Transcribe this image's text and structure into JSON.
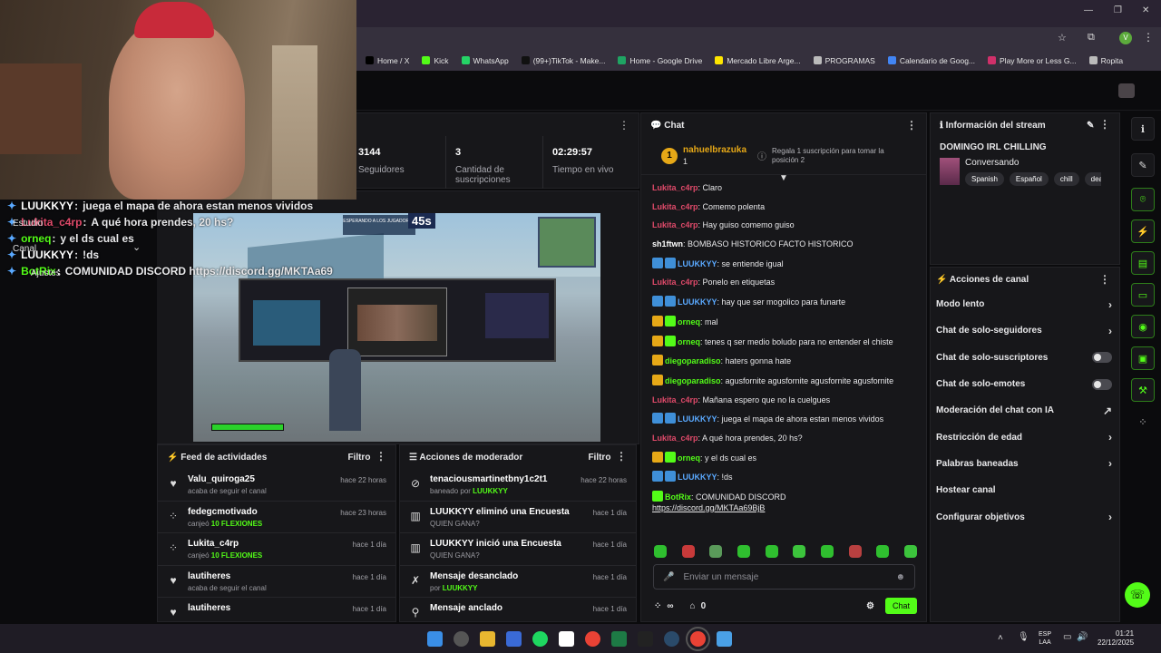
{
  "browser": {
    "bookmarks": [
      {
        "label": "Home / X",
        "color": "#000000"
      },
      {
        "label": "Kick",
        "color": "#53fc18"
      },
      {
        "label": "WhatsApp",
        "color": "#25d366"
      },
      {
        "label": "(99+)TikTok - Make...",
        "color": "#111111"
      },
      {
        "label": "Home - Google Drive",
        "color": "#1fa463"
      },
      {
        "label": "Mercado Libre Arge...",
        "color": "#ffe600"
      },
      {
        "label": "PROGRAMAS",
        "color": "#bbbbbb"
      },
      {
        "label": "Calendario de Goog...",
        "color": "#4285f4"
      },
      {
        "label": "Play More or Less G...",
        "color": "#d0306a"
      },
      {
        "label": "Ropita",
        "color": "#bbbbbb"
      }
    ],
    "profile_initial": "V"
  },
  "overlay": {
    "lines": [
      {
        "user": "LUUKKYY",
        "text": "juega el mapa de ahora estan menos vividos",
        "color": "#ffffff"
      },
      {
        "user": "Lukita_c4rp",
        "text": "A qué hora prendes, 20 hs?",
        "color": "#e04a6a"
      },
      {
        "user": "orneq",
        "text": "y el ds cual es",
        "color": "#53fc18"
      },
      {
        "user": "LUUKKYY",
        "text": "!ds",
        "color": "#ffffff"
      },
      {
        "user": "BotRix",
        "text": "COMUNIDAD DISCORD https://discord.gg/MKTAa69",
        "color": "#53fc18"
      }
    ],
    "menu": [
      "Estudio",
      "Canal",
      "Ajustes"
    ]
  },
  "stats": [
    {
      "value": "3144",
      "label": "Seguidores"
    },
    {
      "value": "3",
      "label": "Cantidad de suscripciones"
    },
    {
      "value": "02:29:57",
      "label": "Tiempo en vivo"
    }
  ],
  "preview": {
    "timer": "45s",
    "banner": "ESPERANDO A LOS JUGADORES"
  },
  "feed": {
    "title": "Feed de actividades",
    "filter": "Filtro",
    "items": [
      {
        "icon": "heart-icon",
        "glyph": "♥",
        "name": "Valu_quiroga25",
        "detail": "acaba de seguir el canal",
        "highlight": "",
        "time": "hace 22 horas"
      },
      {
        "icon": "kick-points-icon",
        "glyph": "⁘",
        "name": "fedegcmotivado",
        "detail": "canjeó ",
        "highlight": "10 FLEXIONES",
        "time": "hace 23 horas"
      },
      {
        "icon": "kick-points-icon",
        "glyph": "⁘",
        "name": "Lukita_c4rp",
        "detail": "canjeó ",
        "highlight": "10 FLEXIONES",
        "time": "hace 1 día"
      },
      {
        "icon": "heart-icon",
        "glyph": "♥",
        "name": "lautiheres",
        "detail": "acaba de seguir el canal",
        "highlight": "",
        "time": "hace 1 día"
      },
      {
        "icon": "heart-icon",
        "glyph": "♥",
        "name": "lautiheres",
        "detail": "",
        "highlight": "",
        "time": "hace 1 día"
      }
    ]
  },
  "modact": {
    "title": "Acciones de moderador",
    "filter": "Filtro",
    "items": [
      {
        "icon": "ban-icon",
        "glyph": "⊘",
        "name": "tenaciousmartinetbny1c2t1",
        "pre": "baneado por ",
        "who": "LUUKKYY",
        "time": "hace 22 horas",
        "green_name": false
      },
      {
        "icon": "poll-icon",
        "glyph": "▥",
        "name": "LUUKKYY eliminó una Encuesta",
        "pre": "QUIEN GANA?",
        "who": "",
        "time": "hace 1 día",
        "green_name": true
      },
      {
        "icon": "poll-icon",
        "glyph": "▥",
        "name": "LUUKKYY inició una Encuesta",
        "pre": "QUIEN GANA?",
        "who": "",
        "time": "hace 1 día",
        "green_name": true
      },
      {
        "icon": "unpin-icon",
        "glyph": "✗",
        "name": "Mensaje desanclado",
        "pre": "por ",
        "who": "LUUKKYY",
        "time": "hace 1 día",
        "green_name": false
      },
      {
        "icon": "pin-icon",
        "glyph": "⚲",
        "name": "Mensaje anclado",
        "pre": "",
        "who": "",
        "time": "hace 1 día",
        "green_name": false
      }
    ]
  },
  "chat": {
    "title": "Chat",
    "pinned": {
      "user": "nahuelbrazuka",
      "count": "1",
      "text": "Regala 1 suscripción para tomar la posición 2"
    },
    "messages": [
      {
        "user": "Lukita_c4rp",
        "color": "#e04a6a",
        "text": "Claro",
        "badges": []
      },
      {
        "user": "Lukita_c4rp",
        "color": "#e04a6a",
        "text": "Comemo polenta",
        "badges": []
      },
      {
        "user": "Lukita_c4rp",
        "color": "#e04a6a",
        "text": "Hay guiso comemo guiso",
        "badges": []
      },
      {
        "user": "sh1ftwn",
        "color": "#ffffff",
        "text": "BOMBASO HISTORICO FACTO HISTORICO",
        "badges": []
      },
      {
        "user": "LUUKKYY",
        "color": "#5aa9ff",
        "text": "se entiende igual",
        "badges": [
          "#3f8fd8",
          "#3f8fd8"
        ]
      },
      {
        "user": "Lukita_c4rp",
        "color": "#e04a6a",
        "text": "Ponelo en etiquetas",
        "badges": []
      },
      {
        "user": "LUUKKYY",
        "color": "#5aa9ff",
        "text": "hay que ser mogolico para funarte",
        "badges": [
          "#3f8fd8",
          "#3f8fd8"
        ]
      },
      {
        "user": "orneq",
        "color": "#53fc18",
        "text": "mal",
        "badges": [
          "#e6a817",
          "#53fc18"
        ]
      },
      {
        "user": "orneq",
        "color": "#53fc18",
        "text": "tenes q ser medio boludo para no entender el chiste",
        "badges": [
          "#e6a817",
          "#53fc18"
        ]
      },
      {
        "user": "diegoparadiso",
        "color": "#53fc18",
        "text": "haters gonna hate",
        "badges": [
          "#e6a817"
        ]
      },
      {
        "user": "diegoparadiso",
        "color": "#53fc18",
        "text": "agusfornite agusfornite agusfornite agusfornite",
        "badges": [
          "#e6a817"
        ]
      },
      {
        "user": "Lukita_c4rp",
        "color": "#e04a6a",
        "text": "Mañana espero que no la cuelgues",
        "badges": []
      },
      {
        "user": "LUUKKYY",
        "color": "#5aa9ff",
        "text": "juega el mapa de ahora estan menos vividos",
        "badges": [
          "#3f8fd8",
          "#3f8fd8"
        ]
      },
      {
        "user": "Lukita_c4rp",
        "color": "#e04a6a",
        "text": "A qué hora prendes, 20 hs?",
        "badges": []
      },
      {
        "user": "orneq",
        "color": "#53fc18",
        "text": "y el ds cual es",
        "badges": [
          "#e6a817",
          "#53fc18"
        ]
      },
      {
        "user": "LUUKKYY",
        "color": "#5aa9ff",
        "text": "!ds",
        "badges": [
          "#3f8fd8",
          "#3f8fd8"
        ]
      },
      {
        "user": "BotRix",
        "color": "#53fc18",
        "text": "COMUNIDAD DISCORD",
        "link": "https://discord.gg/MKTAa69BjB",
        "badges": [
          "#53fc18"
        ]
      }
    ],
    "input_placeholder": "Enviar un mensaje",
    "points": "∞",
    "gifts": "0",
    "send": "Chat"
  },
  "info": {
    "title": "Información del stream",
    "stream_title": "DOMINGO IRL CHILLING",
    "category": "Conversando",
    "tags": [
      "Spanish",
      "Español",
      "chill",
      "deadbyd"
    ]
  },
  "actions": {
    "title": "Acciones de canal",
    "rows": [
      {
        "label": "Modo lento",
        "kind": "chevron"
      },
      {
        "label": "Chat de solo-seguidores",
        "kind": "chevron"
      },
      {
        "label": "Chat de solo-suscriptores",
        "kind": "toggle"
      },
      {
        "label": "Chat de solo-emotes",
        "kind": "toggle"
      },
      {
        "label": "Moderación del chat con IA",
        "kind": "external"
      },
      {
        "label": "Restricción de edad",
        "kind": "chevron"
      },
      {
        "label": "Palabras baneadas",
        "kind": "chevron"
      },
      {
        "label": "Hostear canal",
        "kind": "none"
      },
      {
        "label": "Configurar objetivos",
        "kind": "chevron"
      }
    ]
  },
  "taskbar": {
    "lang": "ESP",
    "lang2": "LAA",
    "time": "01:21",
    "date": "22/12/2025"
  }
}
